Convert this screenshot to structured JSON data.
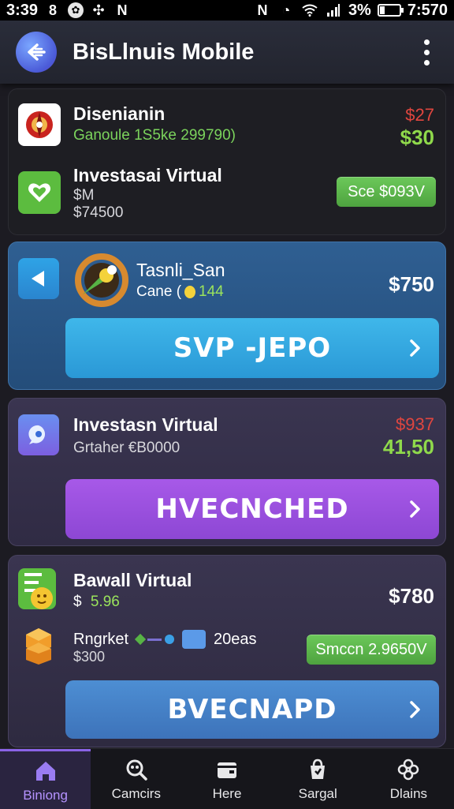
{
  "status_bar": {
    "time": "3:39",
    "signal_text": "3%",
    "clock_right": "7:570",
    "icons_left": [
      "8",
      "flower-icon",
      "badge-icon",
      "n-icon"
    ],
    "icons_right": [
      "n-letter-icon",
      "clock-icon",
      "wifi-icon",
      "signal-icon",
      "battery-icon"
    ]
  },
  "header": {
    "title": "BisLlnuis Mobile",
    "back_icon": "back-arrow-icon",
    "menu_icon": "more-vert-icon"
  },
  "cards": {
    "c1": {
      "item1": {
        "title": "Disenianin",
        "subtitle": "Ganoule 1S5ke 299790)",
        "value_top": "$27",
        "value_bottom": "$30",
        "icon": "red-flower-logo"
      },
      "item2": {
        "title": "Investasai Virtual",
        "line1": "$M",
        "line2": "$74500",
        "pill": "Sce $093V",
        "icon": "green-heart-icon"
      }
    },
    "c2": {
      "title": "Tasnli_San",
      "subtitle": "Cane (",
      "subtitle_accent": "144",
      "value": "$750",
      "button": "SVP -JEPO",
      "icon_left": "play-back-icon",
      "icon_main": "orange-ring-logo"
    },
    "c3": {
      "title": "Investasn Virtual",
      "subtitle": "Grtaher €B0000",
      "value_top": "$937",
      "value_bottom": "41,50",
      "button": "HVECNCHED",
      "icon": "chat-bubble-icon"
    },
    "c4": {
      "title": "Bawall Virtual",
      "subtitle_prefix": "$",
      "subtitle_value": "5.96",
      "value": "$780",
      "row2_title": "Rngrket",
      "row2_sub": "$300",
      "row2_extra": "20eas",
      "pill": "Smccn 2.9650V",
      "button": "BVECNAPD",
      "icon": "green-doc-icon",
      "row2_icon": "orange-cubes-icon"
    }
  },
  "bottom_nav": {
    "items": [
      {
        "label": "Biniong",
        "icon": "home-icon",
        "active": true
      },
      {
        "label": "Camcirs",
        "icon": "search-icon",
        "active": false
      },
      {
        "label": "Here",
        "icon": "wallet-icon",
        "active": false
      },
      {
        "label": "Sargal",
        "icon": "bag-icon",
        "active": false
      },
      {
        "label": "Dlains",
        "icon": "grid-flower-icon",
        "active": false
      }
    ]
  },
  "colors": {
    "accent_purple": "#8a63e6",
    "green": "#8fd94b",
    "red": "#e0463f",
    "blue_button": "#3fb7ea",
    "purple_button": "#a759e8",
    "steel_button": "#4d8ed3"
  }
}
